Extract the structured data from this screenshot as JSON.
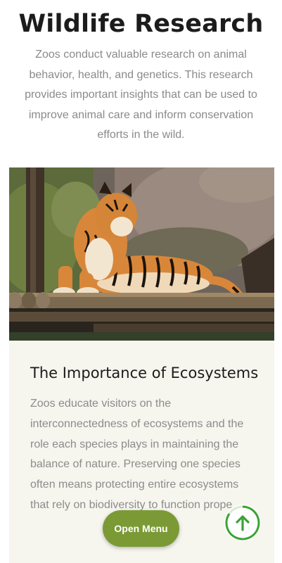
{
  "hero": {
    "title": "Wildlife Research",
    "text": "Zoos conduct valuable research on animal behavior, health, and genetics. This research provides important insights that can be used to improve animal care and inform conservation efforts in the wild."
  },
  "card": {
    "image_subject": "tiger-on-logs",
    "title": "The Importance of Ecosystems",
    "text": "Zoos educate visitors on the interconnectedness of ecosystems and the role each species plays in maintaining the balance of nature. Preserving one species often means protecting entire ecosystems that rely on biodiversity to function prope"
  },
  "floating": {
    "open_menu_label": "Open Menu",
    "back_to_top_icon": "arrow-up-icon"
  },
  "colors": {
    "accent_green": "#7b9a35",
    "progress_green": "#3aa335",
    "card_background": "#f6f5ee"
  }
}
